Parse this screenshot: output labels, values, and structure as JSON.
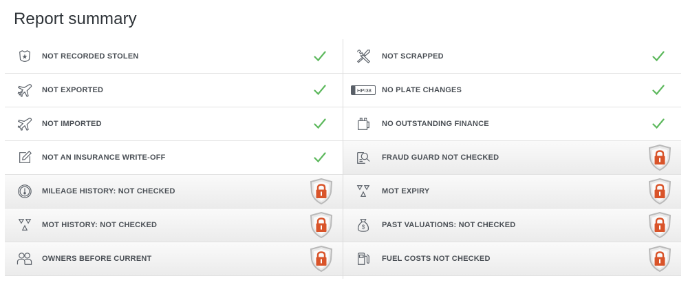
{
  "title": "Report summary",
  "left": [
    {
      "label": "NOT RECORDED STOLEN",
      "icon": "police-badge-icon",
      "status": "check"
    },
    {
      "label": "NOT EXPORTED",
      "icon": "plane-takeoff-icon",
      "status": "check"
    },
    {
      "label": "NOT IMPORTED",
      "icon": "plane-landing-icon",
      "status": "check"
    },
    {
      "label": "NOT AN INSURANCE WRITE-OFF",
      "icon": "pencil-edit-icon",
      "status": "check"
    },
    {
      "label": "MILEAGE HISTORY: NOT CHECKED",
      "icon": "speedometer-icon",
      "status": "locked"
    },
    {
      "label": "MOT HISTORY: NOT CHECKED",
      "icon": "mot-triangles-icon",
      "status": "locked"
    },
    {
      "label": "OWNERS BEFORE CURRENT",
      "icon": "owners-people-icon",
      "status": "locked"
    }
  ],
  "right": [
    {
      "label": "NOT SCRAPPED",
      "icon": "wrench-screwdriver-icon",
      "status": "check"
    },
    {
      "label": "NO PLATE CHANGES",
      "icon": "number-plate-icon",
      "plate_text": "HPI38",
      "status": "check"
    },
    {
      "label": "NO OUTSTANDING FINANCE",
      "icon": "finance-document-icon",
      "status": "check"
    },
    {
      "label": "FRAUD GUARD NOT CHECKED",
      "icon": "fraud-search-icon",
      "status": "locked"
    },
    {
      "label": "MOT EXPIRY",
      "icon": "mot-triangles-icon",
      "status": "locked"
    },
    {
      "label": "PAST VALUATIONS: NOT CHECKED",
      "icon": "money-bag-icon",
      "status": "locked"
    },
    {
      "label": "FUEL COSTS NOT CHECKED",
      "icon": "fuel-pump-icon",
      "status": "locked"
    }
  ],
  "colors": {
    "check": "#5cb85c",
    "lock": "#d9542a",
    "shield": "#b9b9b9",
    "icon": "#5a6068"
  }
}
